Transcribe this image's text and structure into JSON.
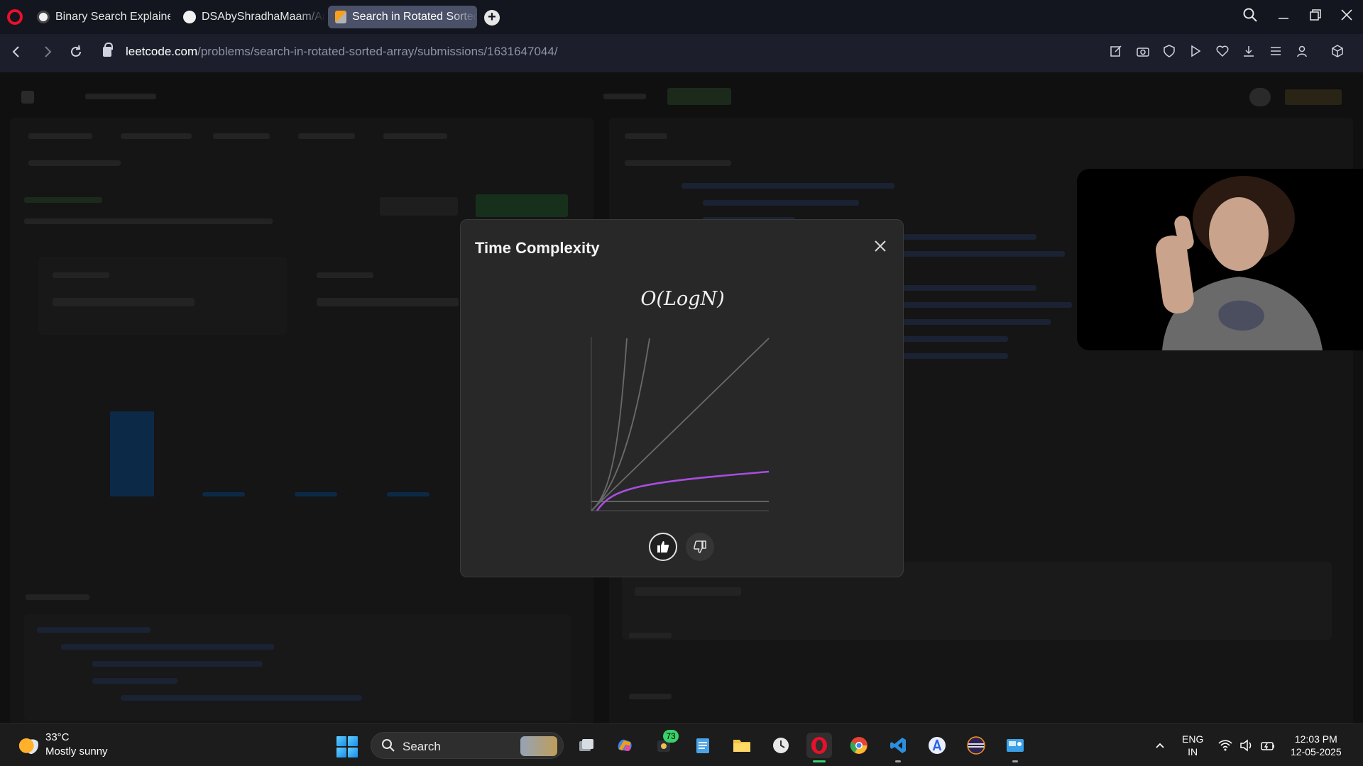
{
  "tabs": [
    {
      "label": "Binary Search Explained"
    },
    {
      "label": "DSAbyShradhaMaam/Arra"
    },
    {
      "label": "Search in Rotated Sorted A"
    }
  ],
  "address": {
    "domain": "leetcode.com",
    "path": "/problems/search-in-rotated-sorted-array/submissions/1631647044/"
  },
  "modal": {
    "title": "Time Complexity",
    "complexity": "O(LogN)",
    "curve_color": "#a84ee0"
  },
  "taskbar": {
    "weather_temp": "33°C",
    "weather_desc": "Mostly sunny",
    "search_label": "Search",
    "notification_count": "73",
    "lang_line1": "ENG",
    "lang_line2": "IN",
    "time": "12:03 PM",
    "date": "12-05-2025"
  },
  "icons": [
    "opera-icon",
    "github-icon",
    "leetcode-icon",
    "back-icon",
    "forward-icon",
    "reload-icon",
    "lock-icon",
    "close-icon",
    "thumbs-up-icon",
    "thumbs-down-icon",
    "windows-start-icon",
    "search-icon",
    "wifi-icon",
    "volume-icon",
    "battery-icon"
  ]
}
